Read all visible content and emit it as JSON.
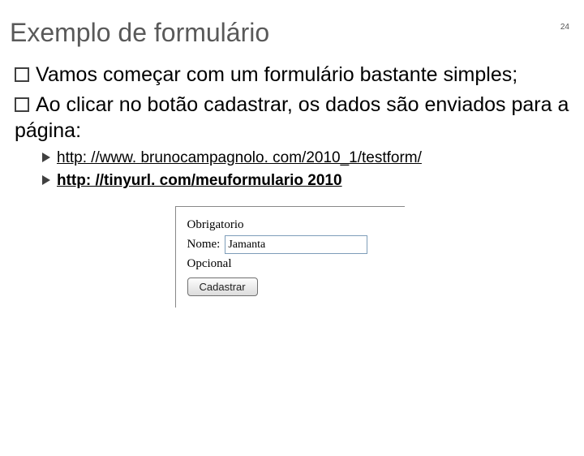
{
  "page_number": "24",
  "title": "Exemplo de formulário",
  "bullets": {
    "b1a": "Vamos começar com um formulário bastante simples;",
    "b1b": "Ao clicar no botão cadastrar, os dados são enviados para a página:",
    "link1": "http: //www. brunocampagnolo. com/2010_1/testform/",
    "link2": "http: //tinyurl. com/meuformulario 2010"
  },
  "form": {
    "group1_label": "Obrigatorio",
    "name_label": "Nome:",
    "name_value": "Jamanta",
    "group2_label": "Opcional",
    "submit_label": "Cadastrar"
  }
}
